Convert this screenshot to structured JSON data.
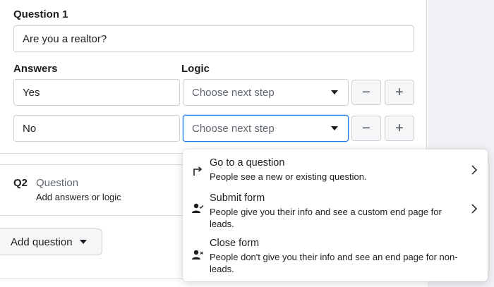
{
  "question1": {
    "label": "Question 1",
    "value": "Are you a realtor?"
  },
  "answers_header": "Answers",
  "logic_header": "Logic",
  "answers": [
    {
      "value": "Yes",
      "logic_placeholder": "Choose next step"
    },
    {
      "value": "No",
      "logic_placeholder": "Choose next step"
    }
  ],
  "buttons": {
    "minus": "−",
    "plus": "+"
  },
  "question2": {
    "number": "Q2",
    "title": "Question",
    "subtitle": "Add answers or logic"
  },
  "add_question_label": "Add question",
  "next_step_menu": [
    {
      "icon": "arrow-turn-icon",
      "title": "Go to a question",
      "description": "People see a new or existing question.",
      "has_submenu": true
    },
    {
      "icon": "person-check-icon",
      "title": "Submit form",
      "description": "People give you their info and see a custom end page for leads.",
      "has_submenu": true
    },
    {
      "icon": "person-x-icon",
      "title": "Close form",
      "description": "People don't give you their info and see an end page for non-leads.",
      "has_submenu": false
    }
  ],
  "colors": {
    "focus": "#1877f2",
    "border": "#ccd0d5",
    "panel_bg": "#f0f2f5"
  }
}
